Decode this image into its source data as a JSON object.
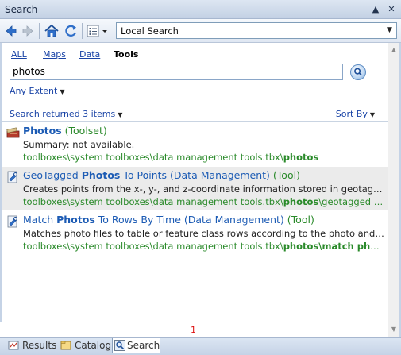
{
  "window": {
    "title": "Search"
  },
  "toolbar": {
    "scope": "Local Search"
  },
  "category_tabs": [
    {
      "label": "ALL",
      "active": false
    },
    {
      "label": "Maps",
      "active": false
    },
    {
      "label": "Data",
      "active": false
    },
    {
      "label": "Tools",
      "active": true
    }
  ],
  "search": {
    "query": "photos",
    "extent": "Any Extent"
  },
  "results_header": {
    "summary": "Search returned 3 items",
    "sort": "Sort By"
  },
  "results": [
    {
      "icon": "toolset-icon",
      "title_match": "Photos",
      "title_rest": "",
      "type": "(Toolset)",
      "description": "Summary: not available.",
      "path_prefix": "toolboxes\\system toolboxes\\data management tools.tbx\\",
      "path_match": "photos",
      "path_suffix": ""
    },
    {
      "icon": "tool-icon",
      "title_pre": "GeoTagged ",
      "title_match": "Photos",
      "title_rest": " To Points (Data Management)",
      "type": "(Tool)",
      "description": "Creates points from the x-, y-, and z-coordinate information stored in geotag…",
      "path_prefix": "toolboxes\\system toolboxes\\data management tools.tbx\\",
      "path_match": "photos",
      "path_suffix": "\\geotagged …"
    },
    {
      "icon": "tool-icon",
      "title_pre": "Match ",
      "title_match": "Photos",
      "title_rest": " To Rows By Time (Data Management)",
      "type": "(Tool)",
      "description": "Matches photo files to table or feature class rows according to the photo and …",
      "path_prefix": "toolboxes\\system toolboxes\\data management tools.tbx\\",
      "path_match": "photos",
      "path_suffix": "\\match pho…"
    }
  ],
  "pager": {
    "page": "1"
  },
  "bottom_tabs": [
    {
      "label": "Results",
      "selected": false
    },
    {
      "label": "Catalog",
      "selected": false
    },
    {
      "label": "Search",
      "selected": true
    }
  ],
  "colors": {
    "link": "#1a44a6",
    "title": "#1c5bb4",
    "path": "#2a8a2a",
    "pager": "#dd1111"
  }
}
